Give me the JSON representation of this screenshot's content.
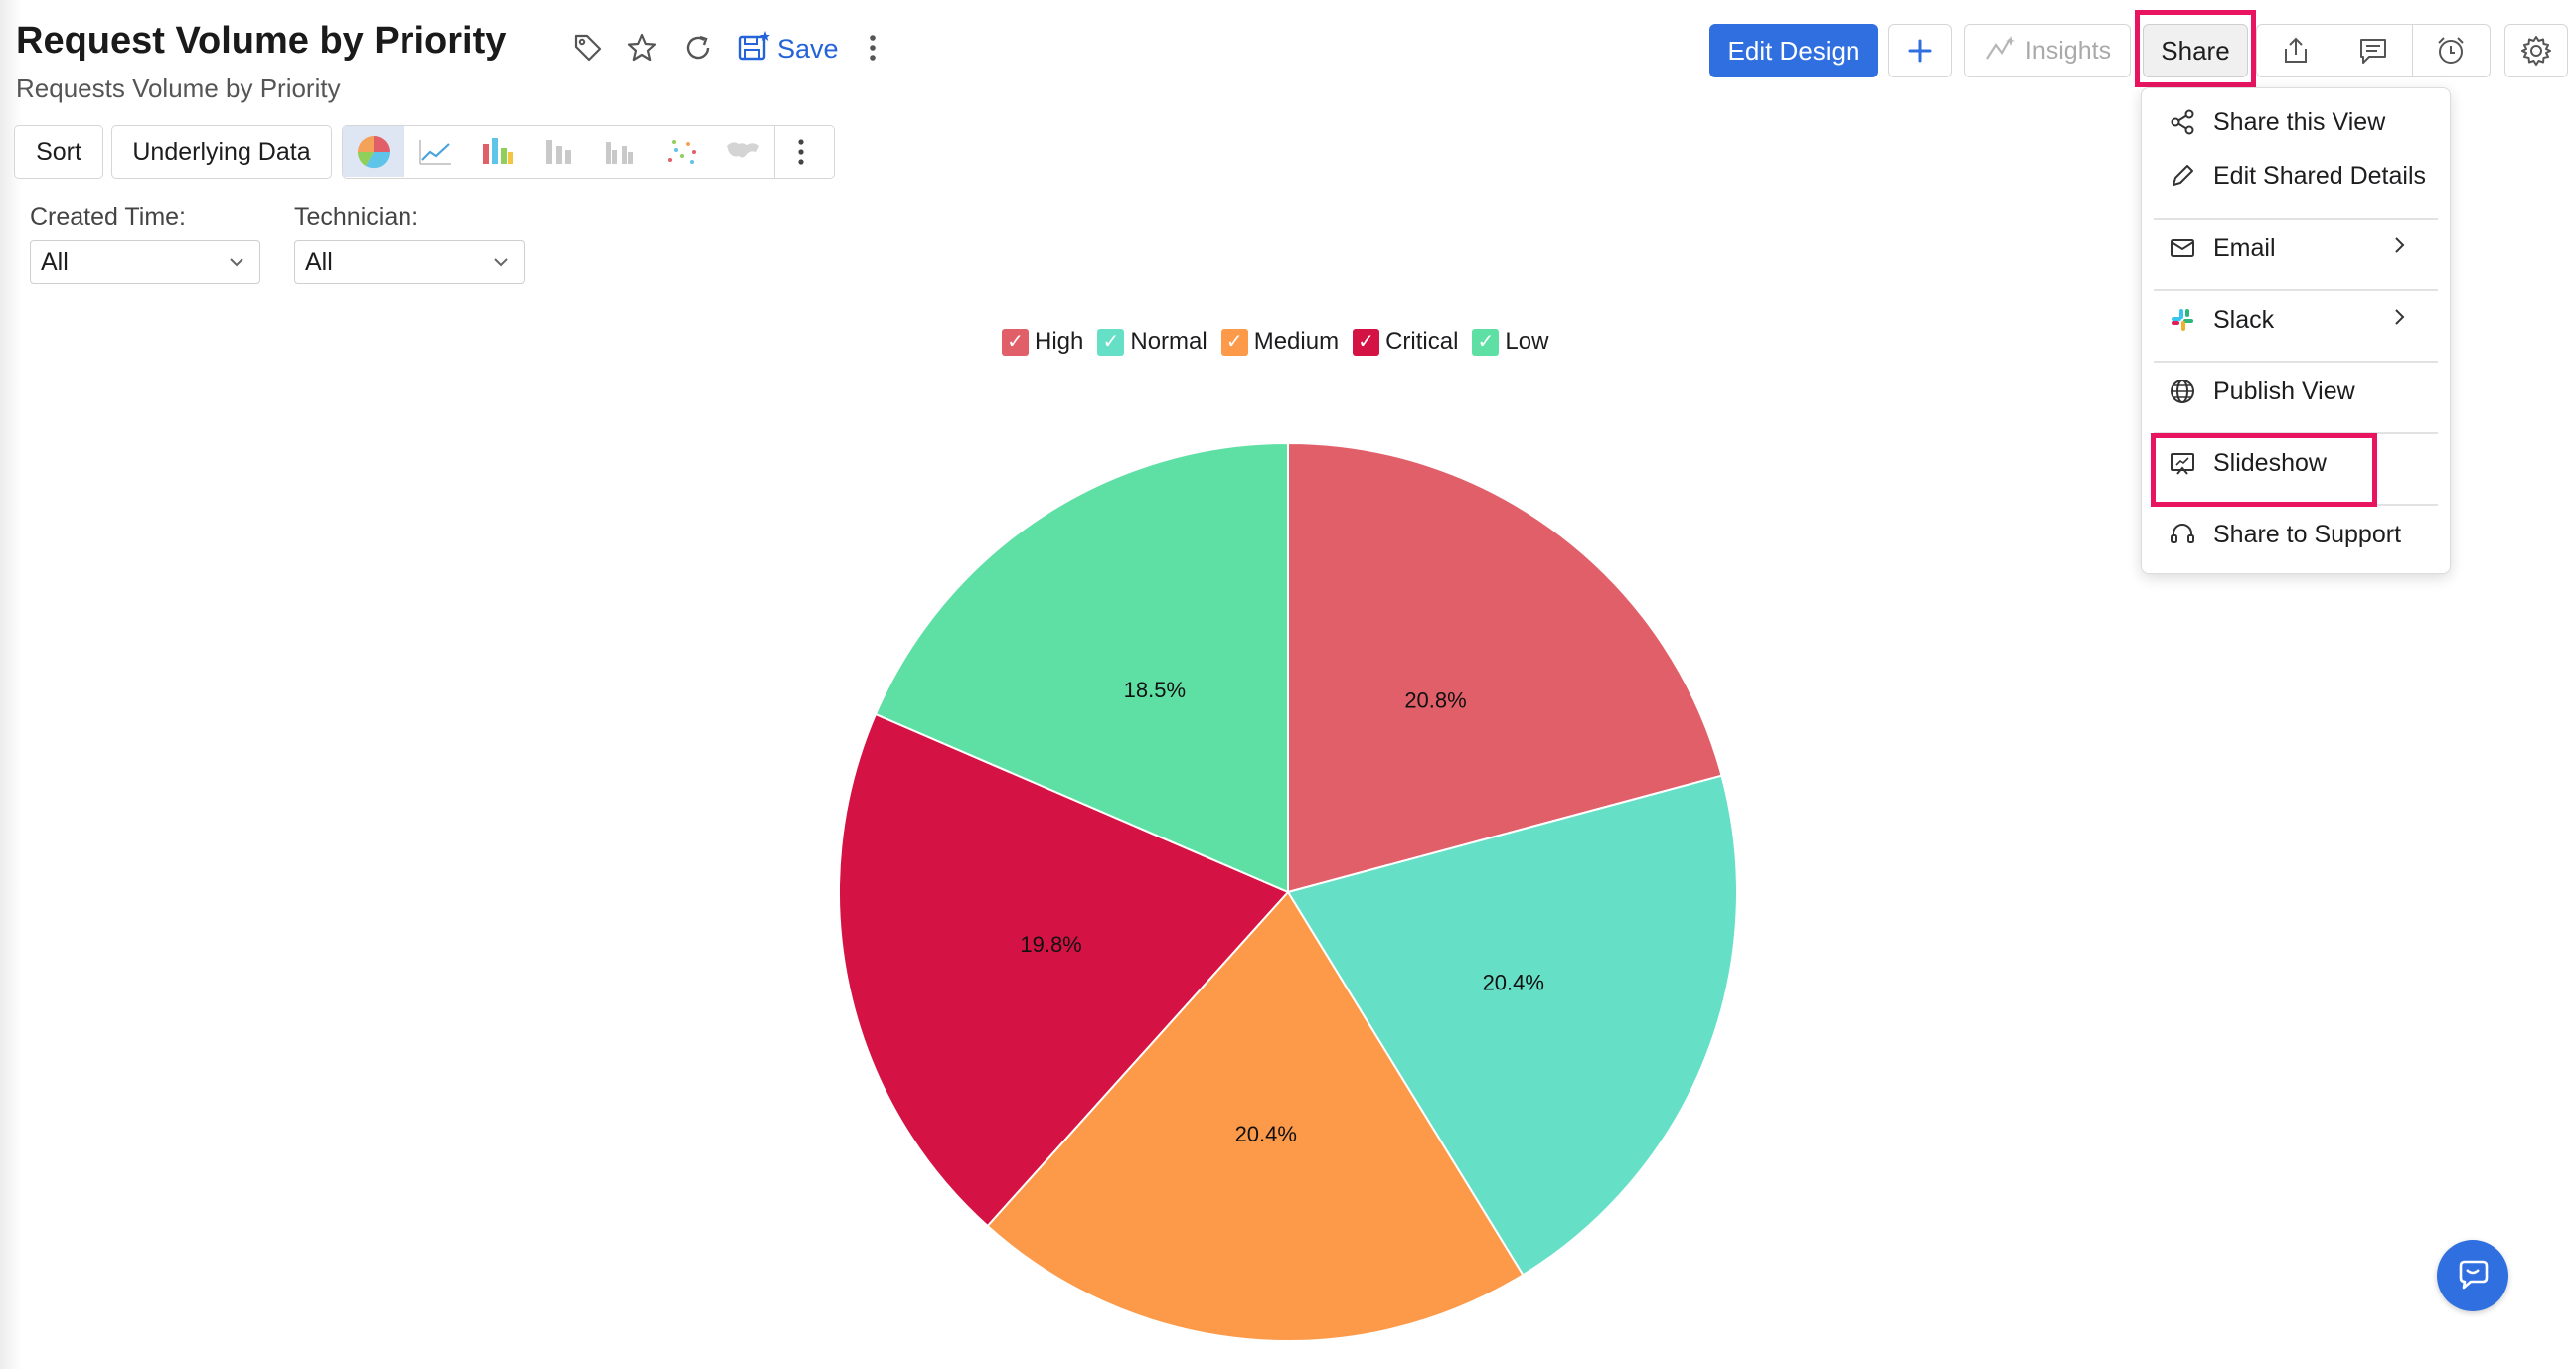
{
  "header": {
    "title": "Request Volume by Priority",
    "subtitle": "Requests Volume by Priority",
    "save_label": "Save"
  },
  "icons": {
    "tag": "tag-icon",
    "star": "star-icon",
    "refresh": "refresh-icon",
    "save": "save-icon",
    "more": "more-vertical-icon",
    "export": "export-icon",
    "comment": "comment-icon",
    "alarm": "alarm-icon",
    "settings": "gear-icon",
    "chat": "chat-icon"
  },
  "toolbar": {
    "sort_label": "Sort",
    "underlying_label": "Underlying Data",
    "chart_types": [
      "pie",
      "line",
      "bar",
      "stacked-bar",
      "grouped-bar",
      "scatter",
      "map"
    ],
    "active_chart_type": "pie"
  },
  "filters": [
    {
      "label": "Created Time:",
      "value": "All"
    },
    {
      "label": "Technician:",
      "value": "All"
    }
  ],
  "actions": {
    "edit_design": "Edit Design",
    "insights": "Insights",
    "share": "Share"
  },
  "share_menu": {
    "items": [
      {
        "label": "Share this View",
        "icon": "share-icon"
      },
      {
        "label": "Edit Shared Details",
        "icon": "pencil-icon"
      },
      {
        "label": "Email",
        "icon": "mail-icon",
        "submenu": true
      },
      {
        "label": "Slack",
        "icon": "slack-icon",
        "submenu": true
      },
      {
        "label": "Publish View",
        "icon": "globe-icon"
      },
      {
        "label": "Slideshow",
        "icon": "slideshow-icon"
      },
      {
        "label": "Share to Support",
        "icon": "support-icon"
      }
    ],
    "highlighted": "Slideshow"
  },
  "colors": {
    "accent": "#2f6fe0",
    "highlight": "#e8145f"
  },
  "chart_data": {
    "type": "pie",
    "title": "",
    "legend_position": "top",
    "slices": [
      {
        "name": "High",
        "value": 20.8,
        "label": "20.8%",
        "color": "#e15f68"
      },
      {
        "name": "Normal",
        "value": 20.4,
        "label": "20.4%",
        "color": "#66dfc7"
      },
      {
        "name": "Medium",
        "value": 20.4,
        "label": "20.4%",
        "color": "#fd9a4a"
      },
      {
        "name": "Critical",
        "value": 19.8,
        "label": "19.8%",
        "color": "#d41243"
      },
      {
        "name": "Low",
        "value": 18.5,
        "label": "18.5%",
        "color": "#5ee0a5"
      }
    ]
  }
}
